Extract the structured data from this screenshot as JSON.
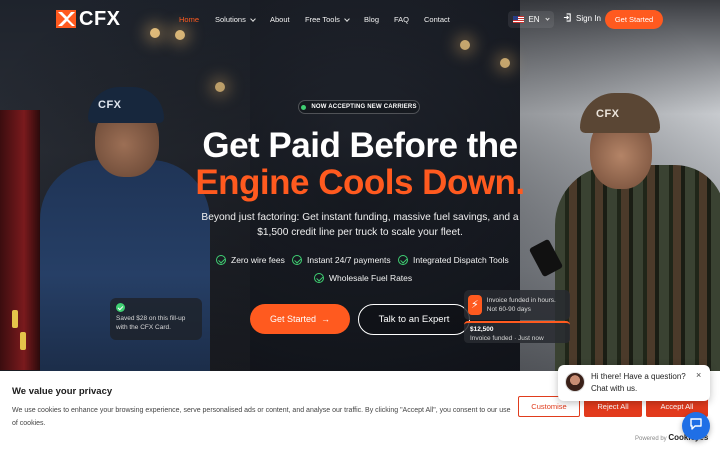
{
  "brand": {
    "name": "CFX",
    "cap_text": "CFX",
    "accent": "#ff5a1f"
  },
  "nav": {
    "items": [
      {
        "label": "Home",
        "active": true
      },
      {
        "label": "Solutions",
        "dropdown": true
      },
      {
        "label": "About"
      },
      {
        "label": "Free Tools",
        "dropdown": true
      },
      {
        "label": "Blog"
      },
      {
        "label": "FAQ"
      },
      {
        "label": "Contact"
      }
    ],
    "language": "EN",
    "sign_in": "Sign In",
    "cta": "Get Started"
  },
  "hero": {
    "badge": "NOW ACCEPTING NEW CARRIERS",
    "headline_line1": "Get Paid Before the",
    "headline_line2": "Engine Cools Down.",
    "subtitle": "Beyond just factoring: Get instant funding, massive fuel savings, and a $1,500 credit line per truck to scale your fleet.",
    "features": [
      "Zero wire fees",
      "Instant 24/7 payments",
      "Integrated Dispatch Tools",
      "Wholesale Fuel Rates"
    ],
    "primary_cta": "Get Started",
    "secondary_cta": "Talk to an Expert",
    "card_saved": "Saved $28 on this fill-up with the CFX Card.",
    "card_invoice": "Invoice funded in hours. Not 60-90 days",
    "card_funded_amount": "$12,500",
    "card_funded_text": "Invoice funded · Just now"
  },
  "cookie": {
    "title": "We value your privacy",
    "text": "We use cookies to enhance your browsing experience, serve personalised ads or content, and analyse our traffic. By clicking \"Accept All\", you consent to our use of cookies.",
    "customise": "Customise",
    "reject": "Reject All",
    "accept": "Accept All",
    "powered_by": "Powered by",
    "powered_brand": "Cookieyes"
  },
  "chat": {
    "message": "Hi there! Have a question? Chat with us.",
    "close": "×"
  }
}
